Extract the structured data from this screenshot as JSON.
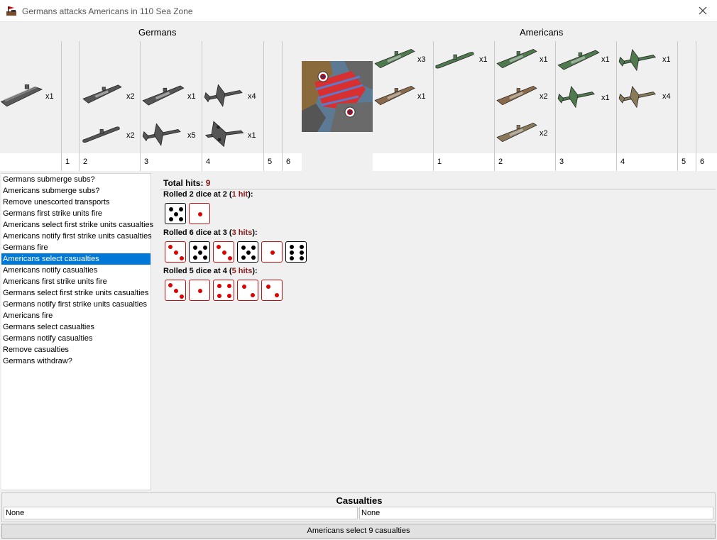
{
  "window": {
    "title": "Germans attacks Americans in 110 Sea Zone",
    "icon": "flag-icon"
  },
  "attacker": {
    "name": "Germans",
    "columns": [
      "",
      "1",
      "2",
      "3",
      "4",
      "5",
      "6"
    ],
    "units": [
      {
        "type": "aircraft-carrier",
        "count": "x1",
        "color": "#555555"
      },
      {
        "type": "destroyer",
        "count": "x2",
        "color": "#555555"
      },
      {
        "type": "submarine",
        "count": "x2",
        "color": "#555555"
      },
      {
        "type": "battleship",
        "count": "x1",
        "color": "#555555"
      },
      {
        "type": "fighter",
        "count": "x5",
        "color": "#555555"
      },
      {
        "type": "tactical-bomber",
        "count": "x4",
        "color": "#555555"
      },
      {
        "type": "bomber",
        "count": "x1",
        "color": "#555555"
      }
    ]
  },
  "defender": {
    "name": "Americans",
    "columns": [
      "",
      "1",
      "2",
      "3",
      "4",
      "5",
      "6"
    ],
    "units": [
      {
        "type": "transport",
        "count": "x3",
        "color": "#4e7a4e"
      },
      {
        "type": "transport",
        "count": "x1",
        "color": "#8a6a4a"
      },
      {
        "type": "submarine",
        "count": "x1",
        "color": "#4e7a4e"
      },
      {
        "type": "destroyer",
        "count": "x1",
        "color": "#4e7a4e"
      },
      {
        "type": "destroyer",
        "count": "x2",
        "color": "#8a6a4a"
      },
      {
        "type": "cruiser",
        "count": "x2",
        "color": "#8a7a5a"
      },
      {
        "type": "battleship",
        "count": "x1",
        "color": "#4e7a4e"
      },
      {
        "type": "fighter",
        "count": "x1",
        "color": "#4e7a4e"
      },
      {
        "type": "fighter",
        "count": "x1",
        "color": "#4e7a4e"
      },
      {
        "type": "fighter",
        "count": "x4",
        "color": "#8a7a5a"
      }
    ]
  },
  "steps": [
    "Germans submerge subs?",
    "Americans submerge subs?",
    "Remove unescorted transports",
    "Germans first strike units fire",
    "Americans select first strike units casualties",
    "Americans notify first strike units casualties",
    "Germans fire",
    "Americans select casualties",
    "Americans notify casualties",
    "Americans first strike units fire",
    "Germans select first strike units casualties",
    "Germans notify first strike units casualties",
    "Americans fire",
    "Germans select casualties",
    "Germans notify casualties",
    "Remove casualties",
    "Germans withdraw?"
  ],
  "selected_step": "Americans select casualties",
  "dice": {
    "total_label": "Total hits:",
    "total_value": "9",
    "rolls": [
      {
        "prefix": "Rolled 2 dice at 2 (",
        "hits": "1 hit",
        "suffix": "):",
        "faces": [
          5,
          1
        ],
        "hit_flags": [
          false,
          true
        ]
      },
      {
        "prefix": "Rolled 6 dice at 3 (",
        "hits": "3 hits",
        "suffix": "):",
        "faces": [
          3,
          5,
          3,
          5,
          1,
          6
        ],
        "hit_flags": [
          true,
          false,
          true,
          false,
          true,
          false
        ]
      },
      {
        "prefix": "Rolled 5 dice at 4 (",
        "hits": "5 hits",
        "suffix": "):",
        "faces": [
          3,
          1,
          4,
          2,
          2
        ],
        "hit_flags": [
          true,
          true,
          true,
          true,
          true
        ]
      }
    ]
  },
  "casualties": {
    "title": "Casualties",
    "attacker_value": "None",
    "defender_value": "None"
  },
  "status_button": "Americans select 9 casualties",
  "colors": {
    "hit_red": "#e00000",
    "selection_blue": "#0078d7",
    "hits_text": "#8b1a1a"
  }
}
